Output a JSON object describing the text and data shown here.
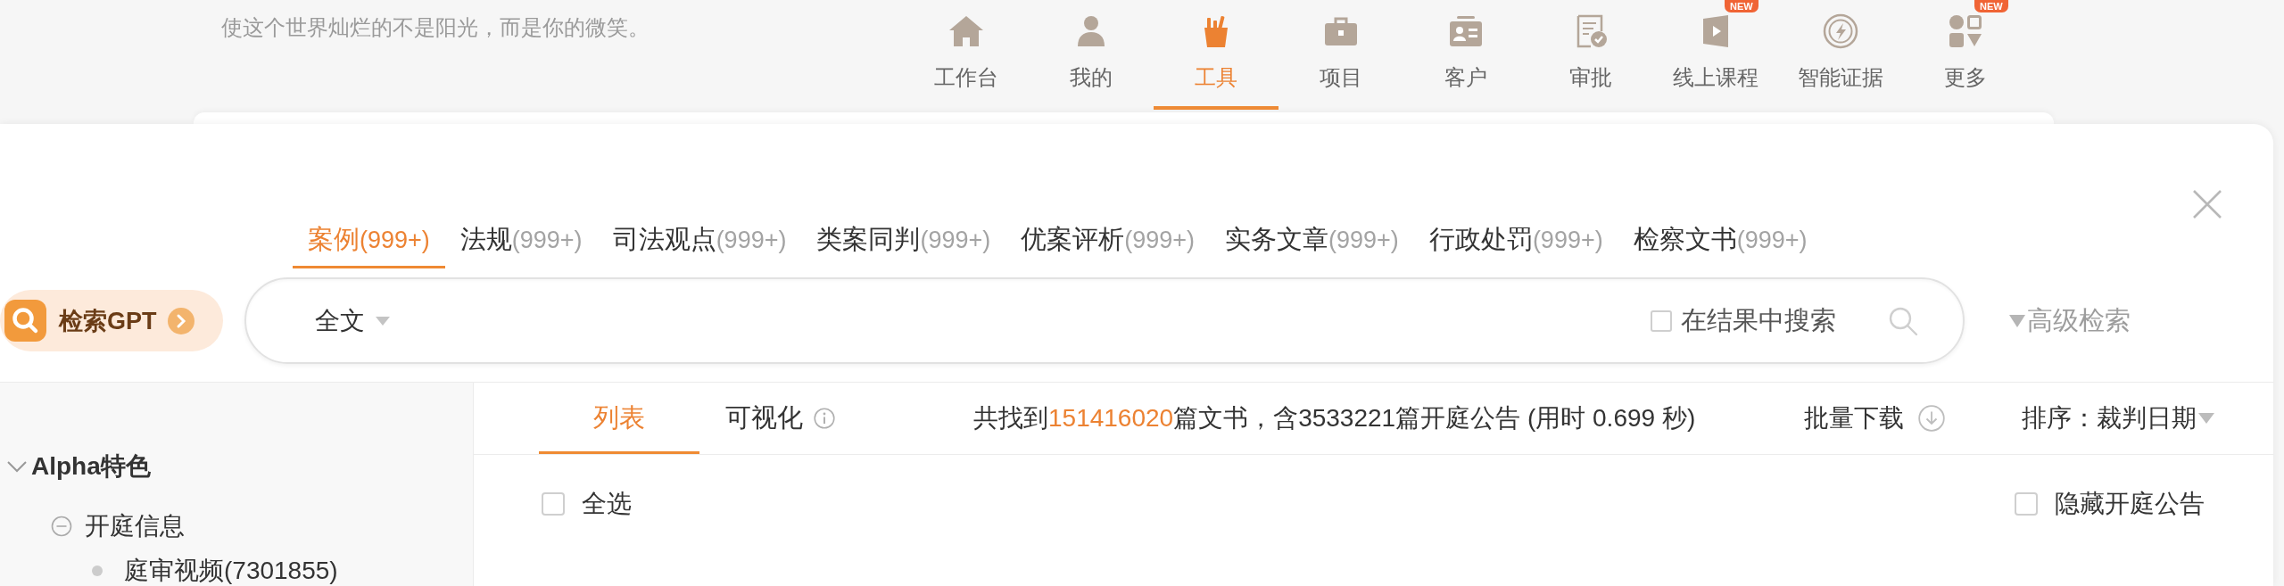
{
  "header": {
    "motto": "使这个世界灿烂的不是阳光，而是你的微笑。",
    "nav": [
      {
        "label": "工作台",
        "selected": false
      },
      {
        "label": "我的",
        "selected": false
      },
      {
        "label": "工具",
        "selected": true
      },
      {
        "label": "项目",
        "selected": false
      },
      {
        "label": "客户",
        "selected": false
      },
      {
        "label": "审批",
        "selected": false
      },
      {
        "label": "线上课程",
        "selected": false,
        "badge": "NEW"
      },
      {
        "label": "智能证据",
        "selected": false
      },
      {
        "label": "更多",
        "selected": false,
        "badge": "NEW"
      }
    ]
  },
  "tabs": [
    {
      "label": "案例",
      "count": "(999+)",
      "selected": true
    },
    {
      "label": "法规",
      "count": "(999+)",
      "selected": false
    },
    {
      "label": "司法观点",
      "count": "(999+)",
      "selected": false
    },
    {
      "label": "类案同判",
      "count": "(999+)",
      "selected": false
    },
    {
      "label": "优案评析",
      "count": "(999+)",
      "selected": false
    },
    {
      "label": "实务文章",
      "count": "(999+)",
      "selected": false
    },
    {
      "label": "行政处罚",
      "count": "(999+)",
      "selected": false
    },
    {
      "label": "检察文书",
      "count": "(999+)",
      "selected": false
    }
  ],
  "search_bar": {
    "gpt_button": "检索GPT",
    "scope": "全文",
    "within_results": {
      "label": "在结果中搜索",
      "checked": false
    },
    "advanced": "高级检索"
  },
  "sidebar": {
    "items": [
      {
        "label": "Alpha特色",
        "expanded": true,
        "children": [
          {
            "label": "开庭信息",
            "expanded": true,
            "children": [
              {
                "label": "庭审视频(7301855)"
              }
            ]
          }
        ]
      }
    ]
  },
  "results": {
    "views": [
      {
        "label": "列表",
        "selected": true,
        "info": false
      },
      {
        "label": "可视化",
        "selected": false,
        "info": true
      }
    ],
    "summary": {
      "prefix": "共找到",
      "count": "151416020",
      "suffix": "篇文书，含3533221篇开庭公告 (用时 0.699 秒)"
    },
    "download": "批量下载",
    "sort": {
      "label": "排序：",
      "value": "裁判日期"
    },
    "select_all": {
      "label": "全选",
      "checked": false
    },
    "hide_announcements": {
      "label": "隐藏开庭公告",
      "checked": false
    }
  }
}
